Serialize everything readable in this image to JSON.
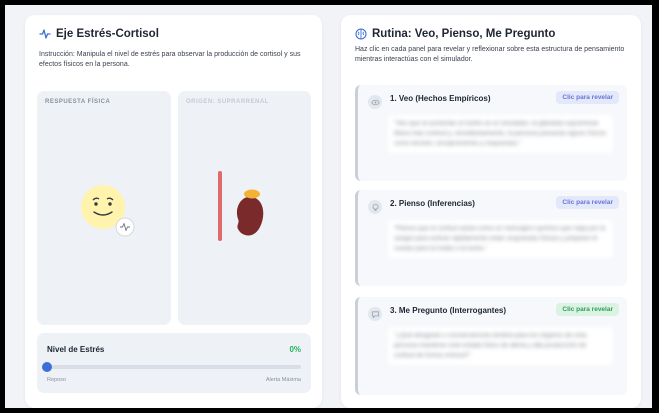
{
  "left": {
    "title": "Eje Estrés-Cortisol",
    "instruction": "Instrucción: Manipula el nivel de estrés para observar la producción de cortisol y sus efectos físicos en la persona.",
    "panel_physical_label": "RESPUESTA FÍSICA",
    "panel_origin_label": "ORIGEN: SUPRARRENAL",
    "stress_label": "Nivel de Estrés",
    "stress_value_text": "0%",
    "stress_level": 0,
    "slider_min_label": "Reposo",
    "slider_max_label": "Alerta Máxima"
  },
  "right": {
    "title": "Rutina: Veo, Pienso, Me Pregunto",
    "subtitle": "Haz clic en cada panel para revelar y reflexionar sobre esta estructura de pensamiento mientras interactúas con el simulador.",
    "steps": [
      {
        "title": "1. Veo (Hechos Empíricos)",
        "reveal": "Clic para revelar",
        "text": "\"Veo que al aumentar el estrés en el simulador, la glándula suprarrenal libera más cortisol y, simultáneamente, la persona presenta signos físicos como tensión, enrojecimiento y respuestas.\"",
        "icon": "eye-icon"
      },
      {
        "title": "2. Pienso (Inferencias)",
        "reveal": "Clic para revelar",
        "text": "\"Pienso que el cortisol actúa como un mensajero químico que viaja por la sangre para activar rápidamente estas respuestas físicas y preparar el cuerpo para la huida o la lucha.\"",
        "icon": "lightbulb-icon"
      },
      {
        "title": "3. Me Pregunto (Interrogantes)",
        "reveal": "Clic para revelar",
        "text": "\"¿Qué desgaste o consecuencias tendría para los órganos de esta persona mantener este estado físico de alerta y alta producción de cortisol de forma crónica?\"",
        "icon": "chat-icon"
      }
    ]
  },
  "colors": {
    "accent_blue": "#3b6fd8",
    "green_value": "#22b35a",
    "reveal_blue_bg": "#e3e8fb",
    "reveal_blue_text": "#6876d4",
    "reveal_green_bg": "#dcf2e3",
    "reveal_green_text": "#2f9e5a"
  }
}
